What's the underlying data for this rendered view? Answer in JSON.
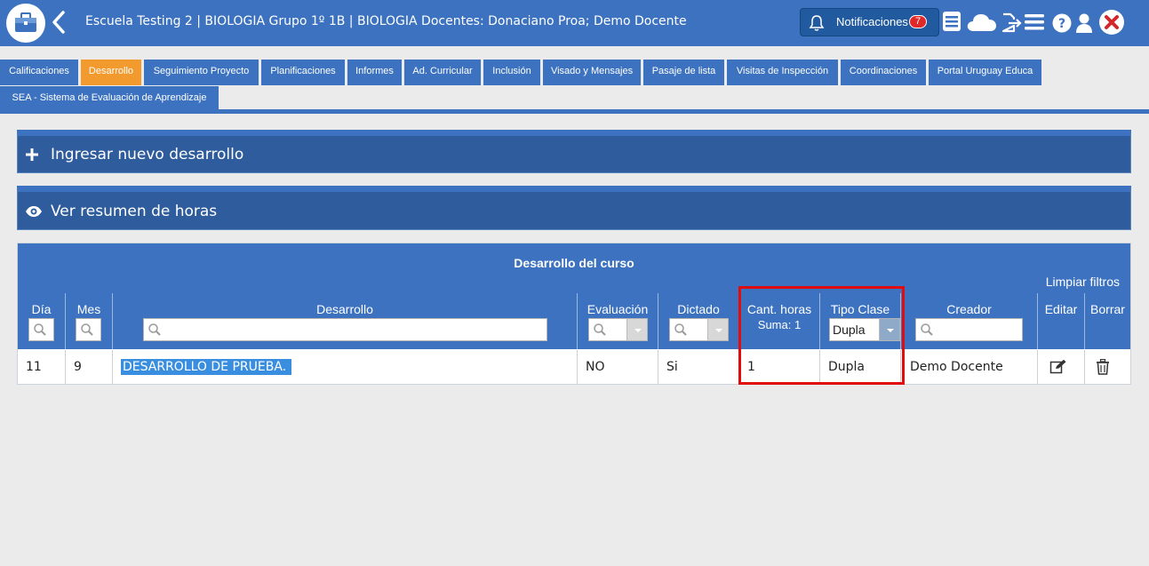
{
  "header": {
    "title": "Escuela Testing 2 | BIOLOGIA Grupo 1º 1B | BIOLOGIA Docentes: Donaciano Proa; Demo Docente",
    "notifications_label": "Notificaciones",
    "notifications_count": "7",
    "icons": [
      "briefcase-icon",
      "back-arrow-icon",
      "bell-icon",
      "list-card-icon",
      "cloud-icon",
      "export-document-icon",
      "menu-icon",
      "help-icon",
      "user-icon",
      "close-icon"
    ]
  },
  "tabs": [
    {
      "label": "Calificaciones",
      "active": false
    },
    {
      "label": "Desarrollo",
      "active": true
    },
    {
      "label": "Seguimiento Proyecto",
      "active": false
    },
    {
      "label": "Planificaciones",
      "active": false
    },
    {
      "label": "Informes",
      "active": false
    },
    {
      "label": "Ad. Curricular",
      "active": false
    },
    {
      "label": "Inclusión",
      "active": false
    },
    {
      "label": "Visado y Mensajes",
      "active": false
    },
    {
      "label": "Pasaje de lista",
      "active": false
    },
    {
      "label": "Visitas de Inspección",
      "active": false
    },
    {
      "label": "Coordinaciones",
      "active": false
    },
    {
      "label": "Portal Uruguay Educa",
      "active": false
    },
    {
      "label": "SEA - Sistema de Evaluación de Aprendizaje",
      "active": false
    }
  ],
  "panels": {
    "new_label": "Ingresar nuevo desarrollo",
    "summary_label": "Ver resumen de horas"
  },
  "grid": {
    "title": "Desarrollo del curso",
    "clear_filters": "Limpiar filtros",
    "columns": {
      "dia": "Día",
      "mes": "Mes",
      "desarrollo": "Desarrollo",
      "evaluacion": "Evaluación",
      "dictado": "Dictado",
      "cant_horas": "Cant. horas",
      "cant_horas_sum": "Suma: 1",
      "tipo_clase": "Tipo Clase",
      "tipo_clase_filter": "Dupla",
      "creador": "Creador",
      "editar": "Editar",
      "borrar": "Borrar"
    },
    "rows": [
      {
        "dia": "11",
        "mes": "9",
        "desarrollo": "DESARROLLO DE PRUEBA.",
        "evaluacion": "NO",
        "dictado": "Si",
        "cant_horas": "1",
        "tipo_clase": "Dupla",
        "creador": "Demo Docente"
      }
    ]
  },
  "colors": {
    "primary": "#3c72bf",
    "panel": "#2e5c9c",
    "active_tab": "#f39a2f",
    "highlight": "#e10d0d",
    "badge": "#e12828",
    "selection": "#3a8ee0"
  }
}
